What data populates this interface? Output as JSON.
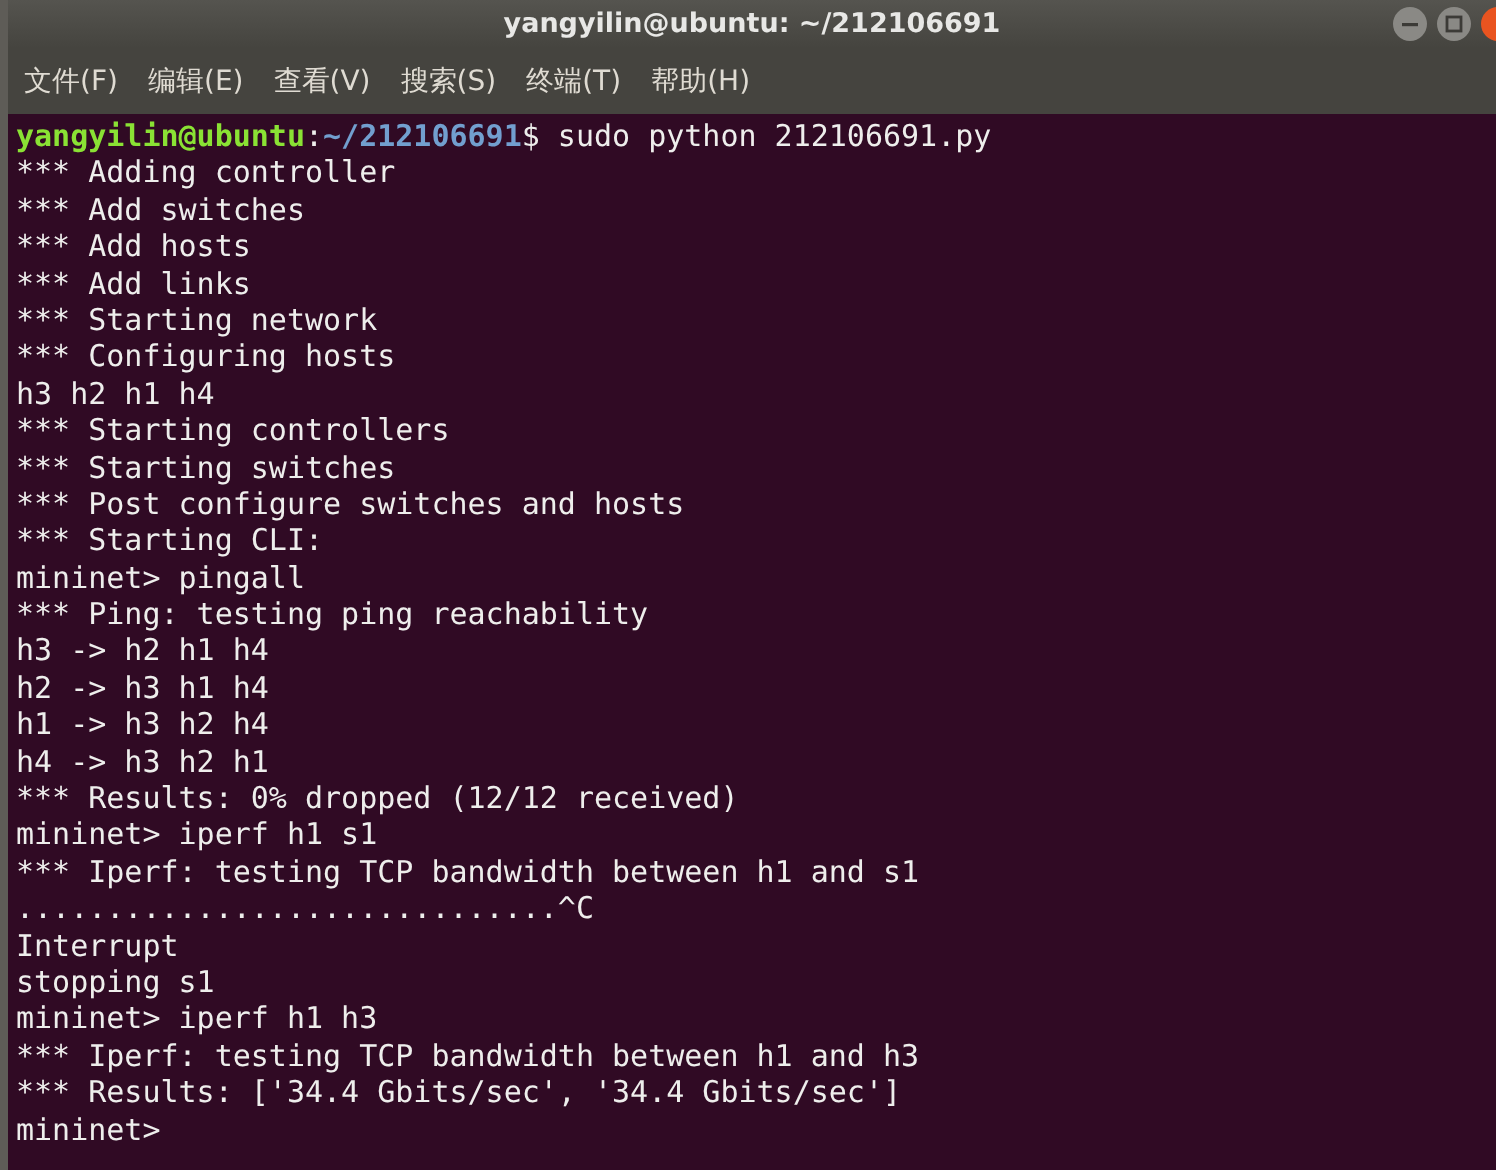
{
  "window": {
    "title": "yangyilin@ubuntu: ~/212106691"
  },
  "menu": [
    "文件(F)",
    "编辑(E)",
    "查看(V)",
    "搜索(S)",
    "终端(T)",
    "帮助(H)"
  ],
  "terminal": {
    "lines": [
      {
        "kind": "prompt",
        "segments": [
          {
            "kind": "user",
            "text": "yangyilin@ubuntu"
          },
          {
            "kind": "plain",
            "text": ":"
          },
          {
            "kind": "path",
            "text": "~/212106691"
          },
          {
            "kind": "plain",
            "text": "$ sudo python 212106691.py"
          }
        ]
      },
      {
        "kind": "output",
        "text": "*** Adding controller"
      },
      {
        "kind": "output",
        "text": "*** Add switches"
      },
      {
        "kind": "output",
        "text": "*** Add hosts"
      },
      {
        "kind": "output",
        "text": "*** Add links"
      },
      {
        "kind": "output",
        "text": "*** Starting network"
      },
      {
        "kind": "output",
        "text": "*** Configuring hosts"
      },
      {
        "kind": "output",
        "text": "h3 h2 h1 h4"
      },
      {
        "kind": "output",
        "text": "*** Starting controllers"
      },
      {
        "kind": "output",
        "text": "*** Starting switches"
      },
      {
        "kind": "output",
        "text": "*** Post configure switches and hosts"
      },
      {
        "kind": "output",
        "text": "*** Starting CLI:"
      },
      {
        "kind": "output",
        "text": "mininet> pingall"
      },
      {
        "kind": "output",
        "text": "*** Ping: testing ping reachability"
      },
      {
        "kind": "output",
        "text": "h3 -> h2 h1 h4"
      },
      {
        "kind": "output",
        "text": "h2 -> h3 h1 h4"
      },
      {
        "kind": "output",
        "text": "h1 -> h3 h2 h4"
      },
      {
        "kind": "output",
        "text": "h4 -> h3 h2 h1"
      },
      {
        "kind": "output",
        "text": "*** Results: 0% dropped (12/12 received)"
      },
      {
        "kind": "output",
        "text": "mininet> iperf h1 s1"
      },
      {
        "kind": "output",
        "text": "*** Iperf: testing TCP bandwidth between h1 and s1"
      },
      {
        "kind": "output",
        "text": "..............................^C"
      },
      {
        "kind": "output",
        "text": "Interrupt"
      },
      {
        "kind": "output",
        "text": "stopping s1"
      },
      {
        "kind": "output",
        "text": "mininet> iperf h1 h3"
      },
      {
        "kind": "output",
        "text": "*** Iperf: testing TCP bandwidth between h1 and h3"
      },
      {
        "kind": "output",
        "text": "*** Results: ['34.4 Gbits/sec', '34.4 Gbits/sec']"
      },
      {
        "kind": "output",
        "text": "mininet>"
      }
    ]
  }
}
